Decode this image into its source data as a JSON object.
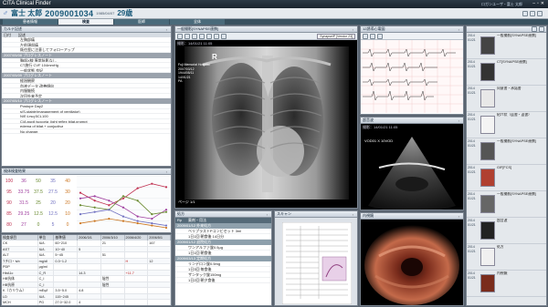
{
  "app": {
    "title": "CITA Clinical Finder",
    "patient_sex": "♂",
    "patient_name": "富士 太郎",
    "patient_id": "2009001034",
    "patient_dob": "1985/04/07",
    "patient_age": "29歳",
    "user": "ロガンユーザ・富士 太郎",
    "tabs": [
      "患者情報",
      "検査",
      "医師",
      "全体"
    ],
    "active_tab": "検査",
    "brand_color": "#1a5a7a"
  },
  "karte": {
    "title": "カルテ記述",
    "col_date": "日付",
    "col_body": "記述",
    "entries": [
      {
        "date": "",
        "lines": [
          "左胸部痛",
          "左前頭部痛",
          "既往歴に注意してフォローアップ"
        ]
      },
      {
        "date": "2007/05/08 プログレスノート",
        "lines": []
      },
      {
        "date": "",
        "lines": [
          "胸部X線 異常陰影なし",
          "CT施行 CVF 104mmHg",
          "一般状態 良好"
        ]
      },
      {
        "date": "2007/05/09 プログレスノート",
        "lines": []
      },
      {
        "date": "",
        "lines": [
          "経過観察",
          "血液データ 改善傾向",
          "内服継続",
          "次回外来予定"
        ]
      },
      {
        "date": "2007/05/10 プログレスノート",
        "lines": []
      },
      {
        "date": "",
        "lines": [
          "Postope Day2",
          "s/S-stable(management of ventilator)",
          "N/E:Lrsq:5CL100",
          "C/A:pupil isocoria ,light reflex bilat,prompt",
          "edema of bilat.+ conjuctiva",
          "No change."
        ]
      }
    ]
  },
  "vitals": {
    "title": "検体検査結果",
    "rows": [
      [
        "100",
        "36",
        "50",
        "35",
        "40"
      ],
      [
        "95",
        "33.75",
        "37.5",
        "27.5",
        "30"
      ],
      [
        "90",
        "31.5",
        "25",
        "20",
        "20"
      ],
      [
        "85",
        "29.25",
        "12.5",
        "12.5",
        "10"
      ],
      [
        "80",
        "27",
        "0",
        "5",
        "0"
      ]
    ],
    "chart_data": {
      "type": "line",
      "x": [
        "2/1",
        "2/2",
        "2/3",
        "2/4",
        "2/5",
        "2/6",
        "2/7"
      ],
      "series": [
        {
          "values": [
            27.5,
            24,
            22,
            25,
            29.5,
            31.5,
            30
          ],
          "color": "#c03050"
        },
        {
          "values": [
            25,
            26,
            24,
            21,
            17,
            16,
            20
          ],
          "color": "#a040a0"
        },
        {
          "values": [
            22,
            21,
            20,
            26,
            24,
            18,
            19
          ],
          "color": "#6a8a30"
        },
        {
          "values": [
            18,
            19,
            20,
            17,
            15,
            14,
            13
          ],
          "color": "#7070c0"
        },
        {
          "values": [
            14,
            15,
            16,
            15,
            14,
            13,
            12
          ],
          "color": "#cc7722"
        }
      ]
    }
  },
  "lab": {
    "headers": [
      "検査項目",
      "単位",
      "基準値",
      "2006/3/1",
      "2006/3/10",
      "2006/4/20",
      "2006/5/1"
    ],
    "rows": [
      [
        "CK",
        "IU/L",
        "60~210",
        "",
        "21",
        "",
        "167"
      ],
      [
        "AST",
        "IU/L",
        "10~40",
        "5",
        "",
        "",
        "",
        "L"
      ],
      [
        "ALT",
        "IU/L",
        "5~45",
        "",
        "51",
        "",
        ""
      ],
      [
        "Tチロ・ivb",
        "mg/dl",
        "0.3~1.2",
        "",
        "",
        "H",
        "12"
      ],
      [
        "PDP",
        "μg/ml",
        "",
        "",
        "",
        "",
        ""
      ],
      [
        "HbA1c",
        "C_R",
        "",
        "14.3",
        "",
        "+11.7",
        ""
      ],
      [
        "HB抗体",
        "C_I",
        "",
        "",
        "陰性",
        "",
        ""
      ],
      [
        "HB抗原",
        "C_I",
        "",
        "",
        "陰性",
        "",
        ""
      ],
      [
        "K（カリウム）",
        "mEq/l",
        "3.5~5.0",
        "4.8",
        "",
        "",
        ""
      ],
      [
        "LD",
        "IU/L",
        "115~245",
        "",
        "",
        "",
        ""
      ],
      [
        "MCH",
        "PG",
        "27.0~32.0",
        "4",
        "",
        "",
        ""
      ]
    ]
  },
  "xray": {
    "title": "一般撮影[SYNAPSE連携]",
    "date": "撮影：14/01/21 11:05",
    "overlay": [
      "Fuji Memorial Hospital",
      "2007/03/12",
      "1944/05/11",
      "14/01/21",
      "PA"
    ],
    "dropdown": "SynapseIP [Vendor 23]",
    "footer": "ページ 1/1"
  },
  "ecg": {
    "title": "12誘導心電図"
  },
  "echo": {
    "title": "超音波",
    "date": "撮影：14/01/21 11:05"
  },
  "endo": {
    "title": "内視鏡"
  },
  "rx": {
    "title": "処方",
    "header": [
      "Rp",
      "薬剤・用法"
    ],
    "items": [
      {
        "date": "2009/01/12 外来処方",
        "drugs": [
          "ベリプラストPコンビセット 3ml",
          "1日1回 朝食後 14日分"
        ]
      },
      {
        "date": "2009/01/12 退院処方",
        "drugs": [
          "ワンアルファ錠0.5μg",
          "1日1回 朝食後"
        ]
      },
      {
        "date": "2009/03/13 定期処方",
        "drugs": [
          "リンデロン錠0.5mg",
          "1日3回 毎食後",
          "ザンタック錠150mg",
          "1日2回 朝夕食後"
        ]
      }
    ]
  },
  "scan": {
    "title": "スキャン"
  },
  "timeline": {
    "items": [
      {
        "year": "2014",
        "date": "01/21",
        "label": "一般撮影[SYNAPSE連携]"
      },
      {
        "year": "2014",
        "date": "01/21",
        "label": "CT[SYNAPSE連携]"
      },
      {
        "year": "2014",
        "date": "01/21",
        "label": "同意書・承諾書"
      },
      {
        "year": "2014",
        "date": "01/21",
        "label": "紹介状（返書・返書）"
      },
      {
        "year": "2014",
        "date": "01/21",
        "label": "一般撮影[SYNAPSE連携]"
      },
      {
        "year": "2014",
        "date": "01/21",
        "label": "GIF[FCS]"
      },
      {
        "year": "2014",
        "date": "01/21",
        "label": "一般撮影[SYNAPSE連携]"
      },
      {
        "year": "2014",
        "date": "01/21",
        "label": "超音波"
      },
      {
        "year": "2014",
        "date": "01/21",
        "label": "処方"
      },
      {
        "year": "2014",
        "date": "01/21",
        "label": "内視鏡"
      }
    ]
  }
}
